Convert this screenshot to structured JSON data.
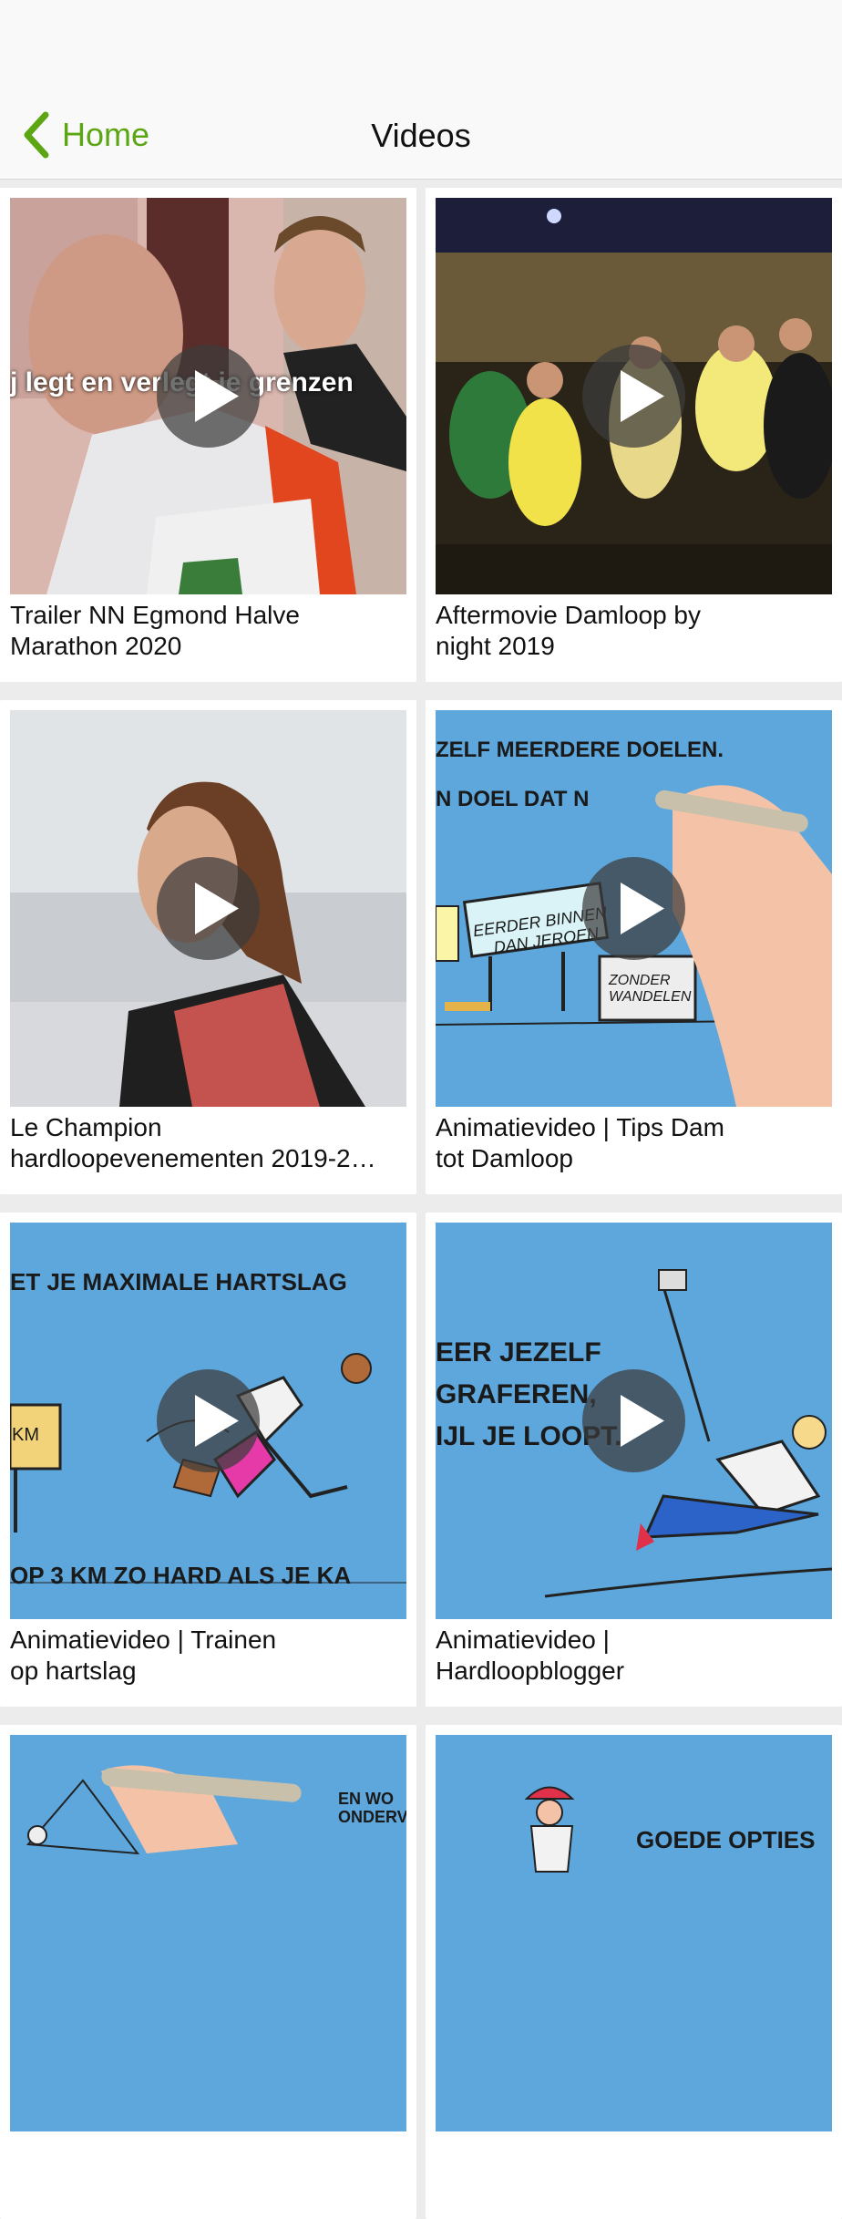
{
  "nav": {
    "back_label": "Home",
    "title": "Videos"
  },
  "videos": [
    {
      "title_line1": "Trailer NN Egmond Halve",
      "title_line2": "Marathon 2020",
      "overlay": "j legt en verlegt je grenzen"
    },
    {
      "title_line1": "Aftermovie Damloop by",
      "title_line2": "night 2019"
    },
    {
      "title_line1": "Le Champion",
      "title_line2": "hardloopevenementen 2019-2…"
    },
    {
      "title_line1": "Animatievideo | Tips Dam",
      "title_line2": "tot Damloop",
      "overlay_lines": [
        "ZELF MEERDERE DOELEN.",
        "N DOEL DAT N"
      ],
      "sign_lines": [
        "EERDER BINNEN",
        "DAN JEROEN"
      ],
      "sign2_lines": [
        "ZONDER",
        "WANDELEN"
      ]
    },
    {
      "title_line1": "Animatievideo | Trainen",
      "title_line2": "op hartslag",
      "overlay_lines": [
        "ET JE MAXIMALE HARTSLAG",
        "OP 3 KM ZO HARD ALS JE KA"
      ],
      "sign": "KM"
    },
    {
      "title_line1": "Animatievideo |",
      "title_line2": "Hardloopblogger",
      "overlay_lines": [
        "EER JEZELF",
        "GRAFEREN,",
        "IJL JE LOOPT."
      ]
    },
    {
      "title_line1": "",
      "title_line2": "",
      "overlay_lines": [
        "EN WO",
        "ONDERV"
      ]
    },
    {
      "title_line1": "",
      "title_line2": "",
      "overlay_lines": [
        "GOEDE OPTIES"
      ]
    }
  ]
}
